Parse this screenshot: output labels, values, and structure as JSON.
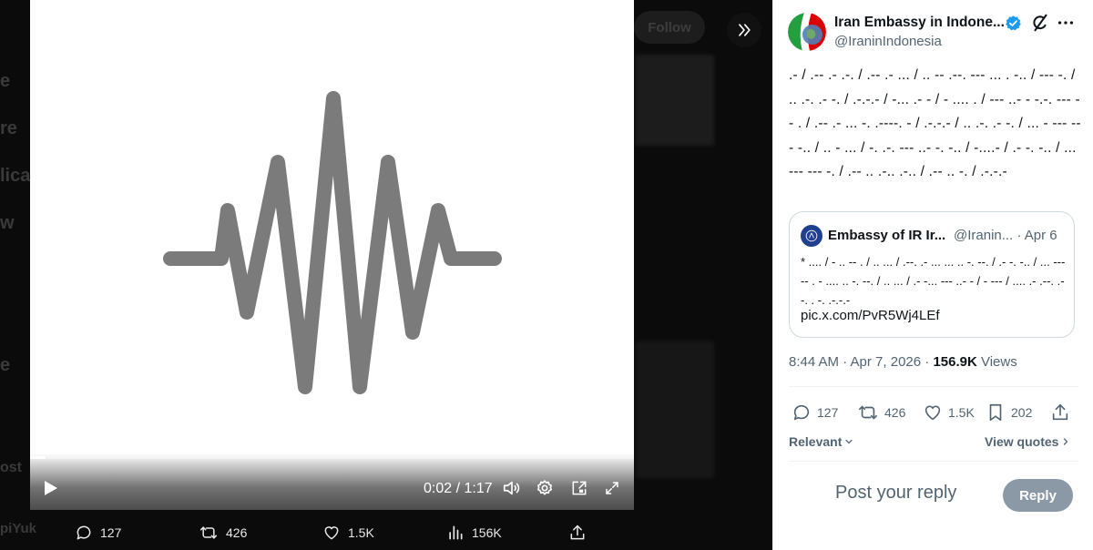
{
  "media": {
    "ghost_sidebar": [
      "e",
      "re",
      "lica",
      "w",
      "e",
      "ost",
      "piYuk"
    ],
    "follow_label": "Follow",
    "video": {
      "current_time": "0:02",
      "duration": "1:17",
      "progress": 0.026
    },
    "actions": {
      "replies": "127",
      "reposts": "426",
      "likes": "1.5K",
      "views": "156K"
    }
  },
  "post": {
    "author_name": "Iran Embassy in Indone...",
    "handle": "@IraninIndonesia",
    "text": ".- / .-- .- .-. / .-- .- ... / .. -- .--. --- ... . -.. / --- -. / .. .-. .- -. / .-.-.- / -... .- - / - .... . / --- ..- - -.-. --- -- . / .-- .- ... -. .----. - / .-.-.- / .. .-. .- -. / ... - --- --- -.. / .. - ... / -. .-. --- ..- -. -.. / -....- / .- -. -.. / ... --- --- -. / .-- .. .-.. .-.. / .-- .. -. / .-.-.-",
    "quote": {
      "name": "Embassy of IR Ir...",
      "handle": "@Iranin...",
      "date": "· Apr 6",
      "text": "* .... / - .. -- . / .. ... / .--. .- ... ... .. -. --. / .- -. -.. / ... --- -- . - .... .. -. --. / .. ... / .- -... --- ..- - / - --- / .... .- .--. .--. . -. .-.-.-",
      "link": "pic.x.com/PvR5Wj4LEf"
    },
    "time": "8:44 AM · Apr 7, 2026 · ",
    "views_count": "156.9K",
    "views_label": " Views",
    "actions": {
      "replies": "127",
      "reposts": "426",
      "likes": "1.5K",
      "bookmarks": "202"
    },
    "sort_label": "Relevant",
    "view_quotes_label": "View quotes",
    "reply_placeholder": "Post your reply",
    "reply_button": "Reply"
  },
  "colors": {
    "waveform": "#7b7b7b",
    "verified": "#1d9bf0",
    "reply_button": "#8b98a5"
  }
}
